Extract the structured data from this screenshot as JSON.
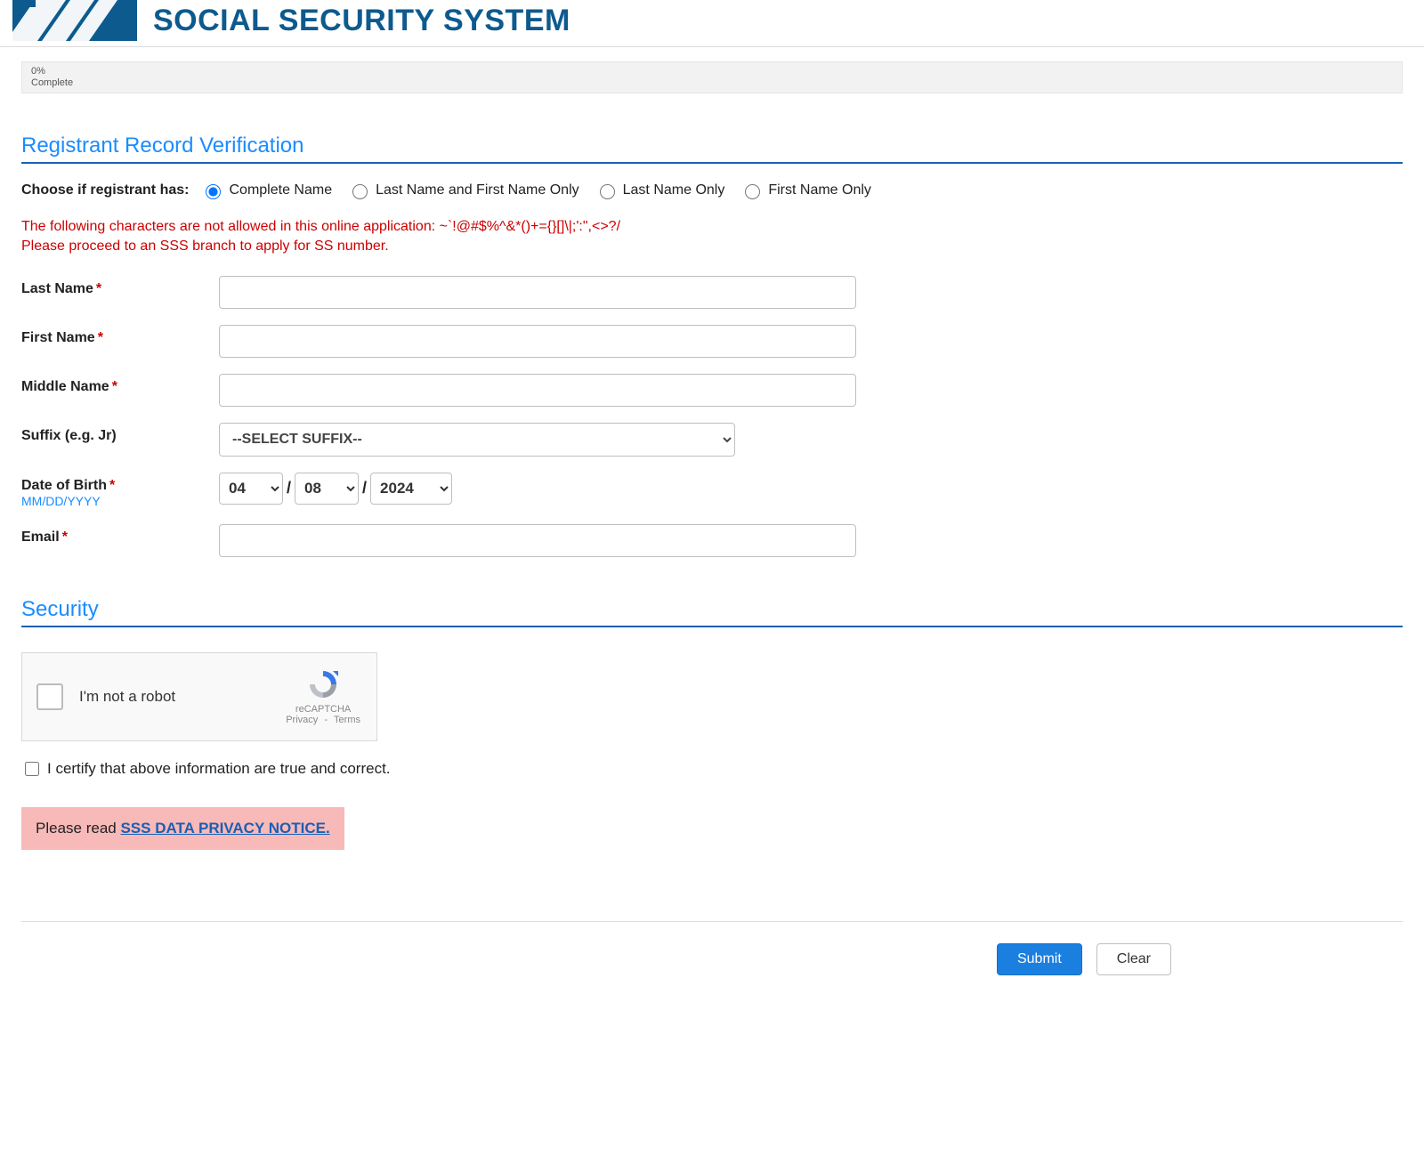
{
  "header": {
    "title": "SOCIAL SECURITY SYSTEM"
  },
  "progress": {
    "percent": "0%",
    "label": "Complete"
  },
  "sections": {
    "verification_title": "Registrant Record Verification",
    "security_title": "Security"
  },
  "registrant_choice": {
    "label": "Choose if registrant has:",
    "options": {
      "complete": "Complete Name",
      "last_first": "Last Name and First Name Only",
      "last_only": "Last Name Only",
      "first_only": "First Name Only"
    }
  },
  "error": {
    "line1": "The following characters are not allowed in this online application: ~`!@#$%^&*()+={}[]\\|;':\",<>?/",
    "line2": "Please proceed to an SSS branch to apply for SS number."
  },
  "labels": {
    "last_name": "Last Name",
    "first_name": "First Name",
    "middle_name": "Middle Name",
    "suffix": "Suffix (e.g. Jr)",
    "dob": "Date of Birth",
    "dob_hint": "MM/DD/YYYY",
    "email": "Email",
    "required": "*"
  },
  "values": {
    "last_name": "",
    "first_name": "",
    "middle_name": "",
    "suffix_selected": "--SELECT SUFFIX--",
    "dob_mm": "04",
    "dob_dd": "08",
    "dob_yyyy": "2024",
    "email": ""
  },
  "recaptcha": {
    "text": "I'm not a robot",
    "brand": "reCAPTCHA",
    "privacy": "Privacy",
    "terms": "Terms"
  },
  "certify": {
    "text": "I certify that above information are true and correct."
  },
  "privacy_notice": {
    "prefix": "Please read",
    "link": "SSS DATA PRIVACY NOTICE."
  },
  "buttons": {
    "submit": "Submit",
    "clear": "Clear"
  }
}
